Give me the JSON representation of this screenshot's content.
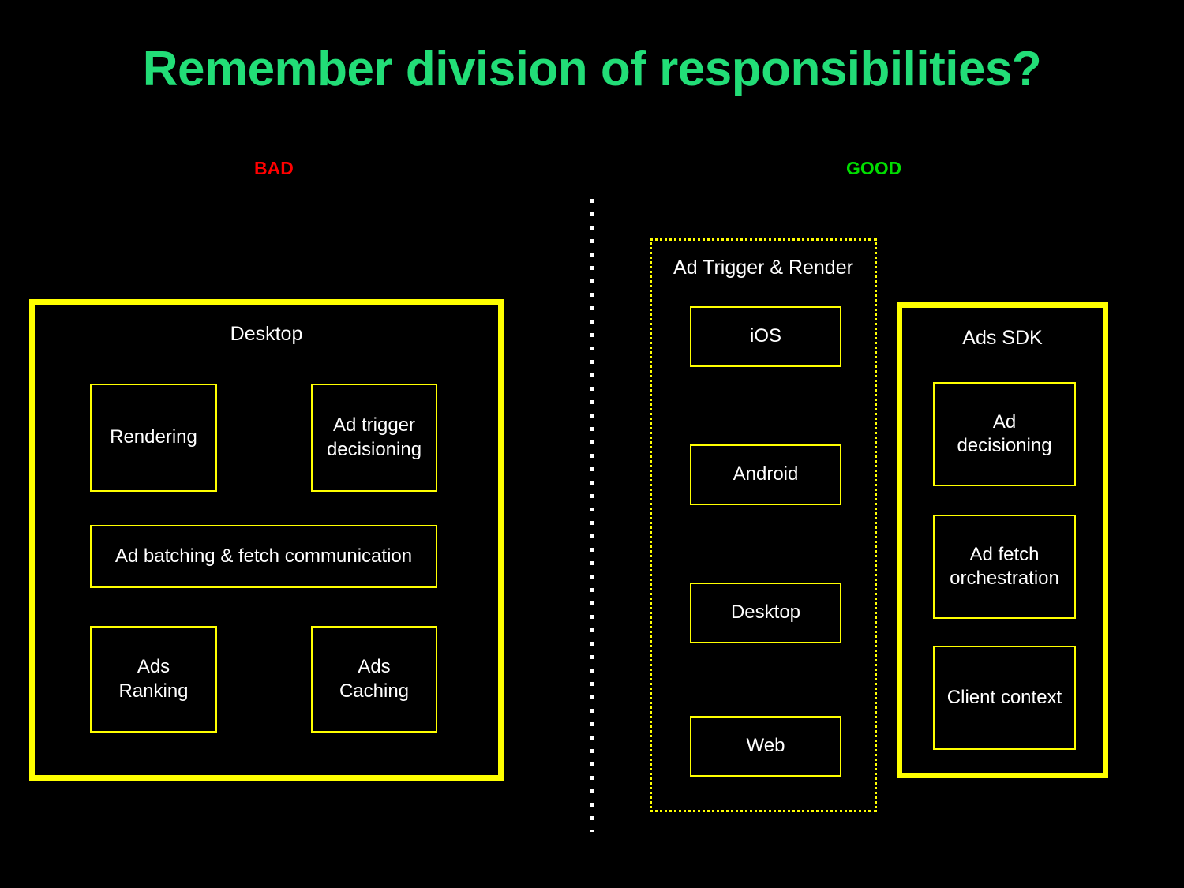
{
  "slide": {
    "title": "Remember division of responsibilities?",
    "title_color": "#22DD77",
    "background_color": "#000000"
  },
  "columns": {
    "bad": {
      "label": "BAD",
      "color": "#FF0000"
    },
    "good": {
      "label": "GOOD",
      "color": "#00DD00"
    }
  },
  "bad_side": {
    "container": {
      "title": "Desktop",
      "border_color": "#FFFF00",
      "items": [
        {
          "label": "Rendering"
        },
        {
          "label": "Ad trigger\ndecisioning"
        },
        {
          "label": "Ad batching & fetch communication"
        },
        {
          "label": "Ads\nRanking"
        },
        {
          "label": "Ads\nCaching"
        }
      ]
    }
  },
  "good_side": {
    "trigger_render": {
      "title": "Ad Trigger & Render",
      "border_color": "#FFFF00",
      "border_style": "dotted",
      "items": [
        {
          "label": "iOS"
        },
        {
          "label": "Android"
        },
        {
          "label": "Desktop"
        },
        {
          "label": "Web"
        }
      ]
    },
    "ads_sdk": {
      "title": "Ads SDK",
      "border_color": "#FFFF00",
      "items": [
        {
          "label": "Ad\ndecisioning"
        },
        {
          "label": "Ad fetch\norchestration"
        },
        {
          "label": "Client context"
        }
      ]
    }
  },
  "divider": {
    "style": "dotted",
    "color": "#FFFFFF",
    "orientation": "vertical"
  }
}
